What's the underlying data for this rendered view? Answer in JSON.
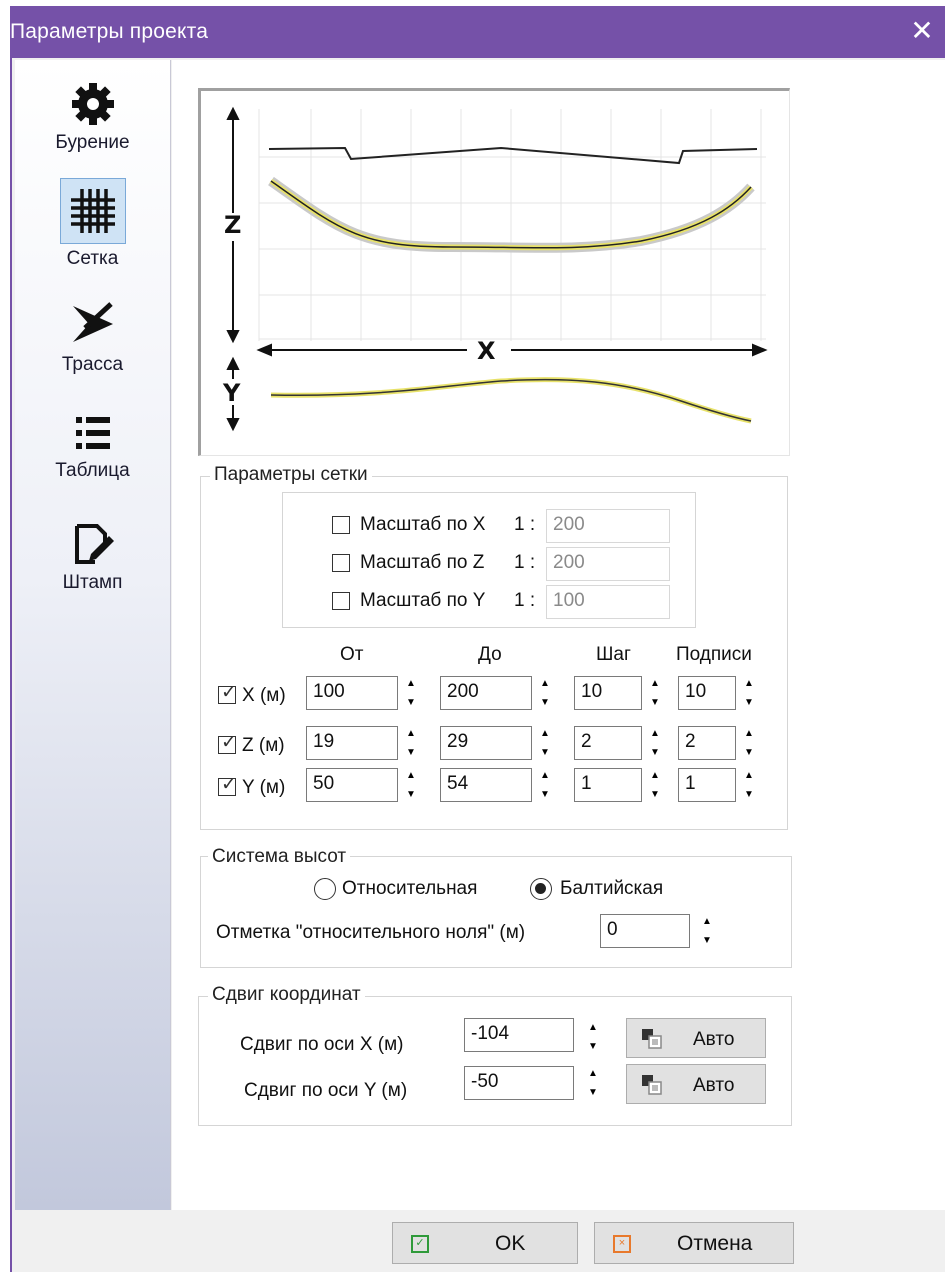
{
  "window": {
    "title": "Параметры проекта",
    "close": "✕"
  },
  "sidebar": {
    "items": [
      {
        "label": "Бурение",
        "icon": "gear-icon"
      },
      {
        "label": "Сетка",
        "icon": "grid-icon",
        "active": true
      },
      {
        "label": "Трасса",
        "icon": "route-icon"
      },
      {
        "label": "Таблица",
        "icon": "list-icon"
      },
      {
        "label": "Штамп",
        "icon": "stamp-edit-icon"
      }
    ]
  },
  "preview": {
    "axis_z": "Z",
    "axis_x": "X",
    "axis_y": "Y"
  },
  "grid_params": {
    "legend": "Параметры сетки",
    "scales": [
      {
        "label": "Масштаб по X",
        "ratio": "1 :",
        "value": "200",
        "checked": false
      },
      {
        "label": "Масштаб по Z",
        "ratio": "1 :",
        "value": "200",
        "checked": false
      },
      {
        "label": "Масштаб по Y",
        "ratio": "1 :",
        "value": "100",
        "checked": false
      }
    ],
    "headers": {
      "from": "От",
      "to": "До",
      "step": "Шаг",
      "labels": "Подписи"
    },
    "rows": [
      {
        "label": "X (м)",
        "checked": true,
        "from": "100",
        "to": "200",
        "step": "10",
        "labels": "10"
      },
      {
        "label": "Z (м)",
        "checked": true,
        "from": "19",
        "to": "29",
        "step": "2",
        "labels": "2"
      },
      {
        "label": "Y (м)",
        "checked": true,
        "from": "50",
        "to": "54",
        "step": "1",
        "labels": "1"
      }
    ]
  },
  "heights": {
    "legend": "Система высот",
    "relative": "Относительная",
    "baltic": "Балтийская",
    "selected": "baltic",
    "zero_label": "Отметка \"относительного ноля\" (м)",
    "zero_value": "0"
  },
  "shift": {
    "legend": "Сдвиг координат",
    "x_label": "Сдвиг по оси X (м)",
    "x_value": "-104",
    "y_label": "Сдвиг по оси Y (м)",
    "y_value": "-50",
    "auto": "Авто"
  },
  "footer": {
    "ok": "OK",
    "cancel": "Отмена"
  },
  "colors": {
    "title_bar": "#7551a8",
    "accent_green": "#2f9a3a",
    "accent_orange": "#e8792c"
  }
}
